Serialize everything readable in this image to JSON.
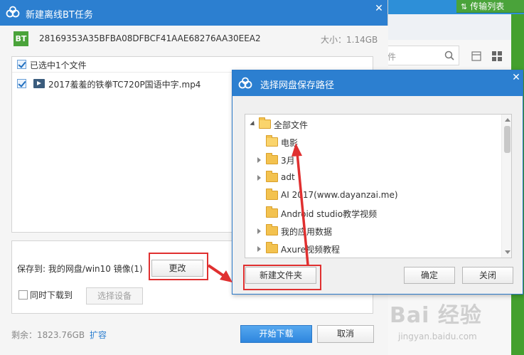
{
  "background": {
    "transfer_list_label": "传输列表",
    "search_tail_text": "件"
  },
  "main_dialog": {
    "title": "新建离线BT任务",
    "bt_badge": "BT",
    "hash": "28169353A35BFBA08DFBCF41AAE68276AA30EEA2",
    "size_text": "大小：1.14GB",
    "selected_summary": "已选中1个文件",
    "files": [
      {
        "name": "2017羞羞的铁拳TC720P国语中字.mp4",
        "checked": true
      }
    ],
    "save_to_label": "保存到: 我的网盘/win10 镜像(1)",
    "change_button": "更改",
    "download_simultaneously_label": "同时下载到",
    "select_device_button": "选择设备",
    "remaining_text": "剩余：1823.76GB",
    "expand_link": "扩容",
    "start_button": "开始下载",
    "cancel_button": "取消"
  },
  "folder_dialog": {
    "title": "选择网盘保存路径",
    "tree": [
      {
        "label": "全部文件",
        "level": 0,
        "expand": "open",
        "open_folder": true
      },
      {
        "label": "电影",
        "level": 1,
        "expand": "none",
        "open_folder": true
      },
      {
        "label": "3月",
        "level": 1,
        "expand": "closed",
        "open_folder": false
      },
      {
        "label": "adt",
        "level": 1,
        "expand": "closed",
        "open_folder": false
      },
      {
        "label": "AI 2017(www.dayanzai.me)",
        "level": 1,
        "expand": "none",
        "open_folder": false
      },
      {
        "label": "Android studio教学视频",
        "level": 1,
        "expand": "none",
        "open_folder": false
      },
      {
        "label": "我的应用数据",
        "level": 1,
        "expand": "closed",
        "open_folder": false
      },
      {
        "label": "Axure视频教程",
        "level": 1,
        "expand": "closed",
        "open_folder": false
      }
    ],
    "new_folder_button": "新建文件夹",
    "ok_button": "确定",
    "close_button": "关闭"
  },
  "watermark": {
    "brand": "Bai 经验",
    "url": "jingyan.baidu.com"
  },
  "colors": {
    "titlebar": "#2c7fd0",
    "bt_green": "#4aa33a",
    "annotation_red": "#e03030",
    "primary_button": "#2e86de"
  }
}
